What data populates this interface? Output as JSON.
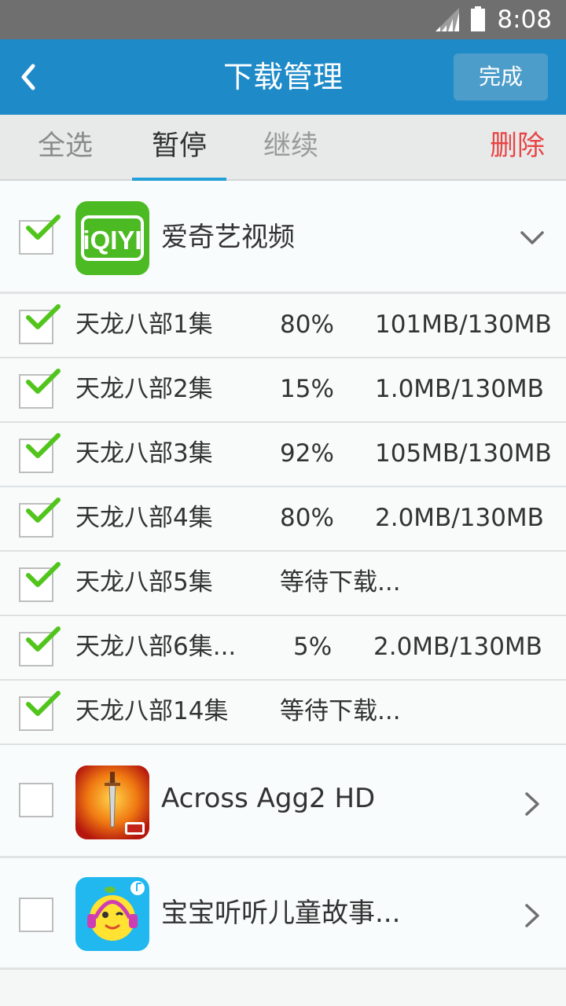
{
  "status_bar": {
    "time": "8:08"
  },
  "header": {
    "back_icon": "back-icon",
    "title": "下载管理",
    "done_label": "完成"
  },
  "toolbar": {
    "select_all": "全选",
    "pause": "暂停",
    "resume": "继续",
    "delete": "删除"
  },
  "groups": [
    {
      "name": "爱奇艺视频",
      "icon": "iqiyi-app-icon",
      "icon_text": "iQIYI",
      "checked": true,
      "expanded": true,
      "episodes": [
        {
          "name": "天龙八部1集",
          "progress": "80%",
          "size": "101MB/130MB",
          "checked": true
        },
        {
          "name": "天龙八部2集",
          "progress": "15%",
          "size": "1.0MB/130MB",
          "checked": true
        },
        {
          "name": "天龙八部3集",
          "progress": "92%",
          "size": "105MB/130MB",
          "checked": true
        },
        {
          "name": "天龙八部4集",
          "progress": "80%",
          "size": "2.0MB/130MB",
          "checked": true
        },
        {
          "name": "天龙八部5集",
          "progress": "等待下载...",
          "size": "",
          "checked": true
        },
        {
          "name": "天龙八部6集...",
          "progress": "5%",
          "size": "2.0MB/130MB",
          "checked": true
        },
        {
          "name": "天龙八部14集",
          "progress": "等待下载...",
          "size": "",
          "checked": true
        }
      ]
    },
    {
      "name": "Across Agg2 HD",
      "icon": "sword-game-icon",
      "checked": false,
      "expanded": false
    },
    {
      "name": "宝宝听听儿童故事...",
      "icon": "kids-story-icon",
      "checked": false,
      "expanded": false
    }
  ]
}
